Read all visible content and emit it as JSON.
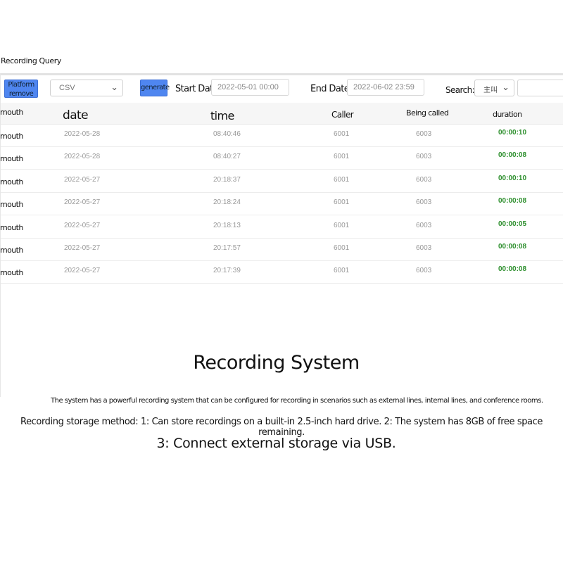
{
  "page_title": "Recording Query",
  "toolbar": {
    "platform_remove_label": "Platform remove",
    "format_select": "CSV",
    "generate_label": "generate",
    "start_date_label": "Start Date:",
    "start_date_value": "2022-05-01 00:00",
    "end_date_label": "End Date:",
    "end_date_value": "2022-06-02 23:59",
    "search_label": "Search:",
    "search_select": "主叫",
    "search_input": ""
  },
  "table": {
    "headers": {
      "month": "mouth",
      "date": "date",
      "time": "time",
      "caller": "Caller",
      "called": "Being called",
      "duration": "duration"
    },
    "rows": [
      {
        "month": "mouth",
        "date": "2022-05-28",
        "time": "08:40:46",
        "caller": "6001",
        "called": "6003",
        "duration": "00:00:10"
      },
      {
        "month": "mouth",
        "date": "2022-05-28",
        "time": "08:40:27",
        "caller": "6001",
        "called": "6003",
        "duration": "00:00:08"
      },
      {
        "month": "mouth",
        "date": "2022-05-27",
        "time": "20:18:37",
        "caller": "6001",
        "called": "6003",
        "duration": "00:00:10"
      },
      {
        "month": "mouth",
        "date": "2022-05-27",
        "time": "20:18:24",
        "caller": "6001",
        "called": "6003",
        "duration": "00:00:08"
      },
      {
        "month": "mouth",
        "date": "2022-05-27",
        "time": "20:18:13",
        "caller": "6001",
        "called": "6003",
        "duration": "00:00:05"
      },
      {
        "month": "mouth",
        "date": "2022-05-27",
        "time": "20:17:57",
        "caller": "6001",
        "called": "6003",
        "duration": "00:00:08"
      },
      {
        "month": "mouth",
        "date": "2022-05-27",
        "time": "20:17:39",
        "caller": "6001",
        "called": "6003",
        "duration": "00:00:08"
      }
    ]
  },
  "footer": {
    "title": "Recording System",
    "description": "The system has a powerful recording system that can be configured for recording in scenarios such as external lines, internal lines, and conference rooms.",
    "storage_line1": "Recording storage method: 1: Can store recordings on a built-in 2.5-inch hard drive. 2: The system has 8GB of free space remaining.",
    "storage_line2": "3: Connect external storage via USB."
  },
  "colors": {
    "button_blue": "#4f86f0",
    "duration_green": "#2d8f2d"
  },
  "icons": {
    "select_chevron": "chevron-down-icon"
  }
}
